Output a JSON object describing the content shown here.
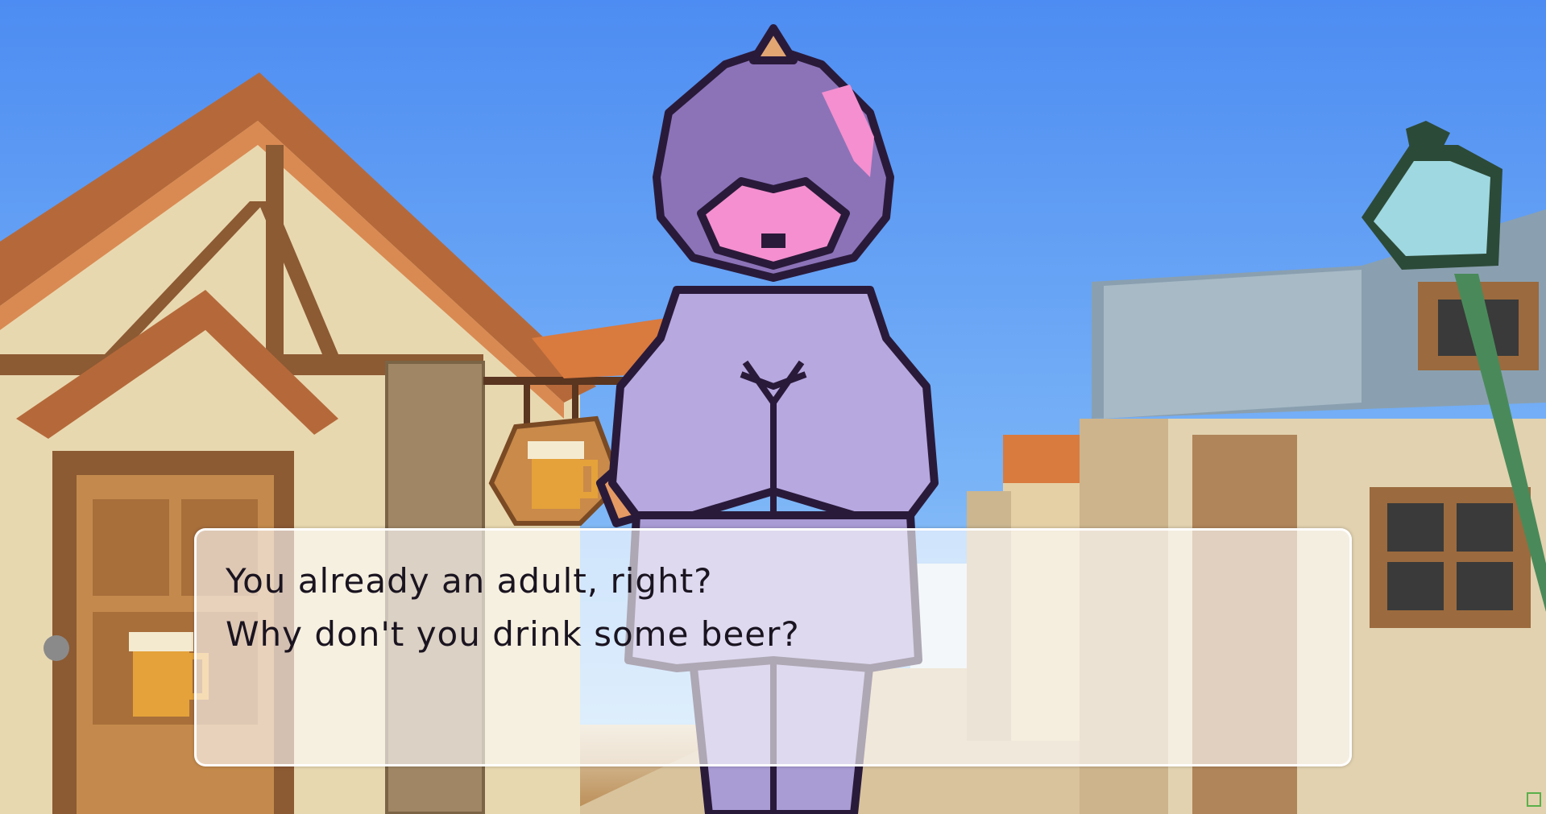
{
  "scene": {
    "setting": "medieval town street",
    "sky_color": "#5b97f2",
    "character": {
      "body_color": "#a99bd4",
      "face_color": "#f58fcf",
      "outline_color": "#2a1a3a"
    },
    "signs": [
      "beer-mug-sign",
      "beer-mug-sign"
    ]
  },
  "dialog": {
    "lines": [
      "You already an adult, right?",
      "Why don't you drink some beer?"
    ]
  }
}
